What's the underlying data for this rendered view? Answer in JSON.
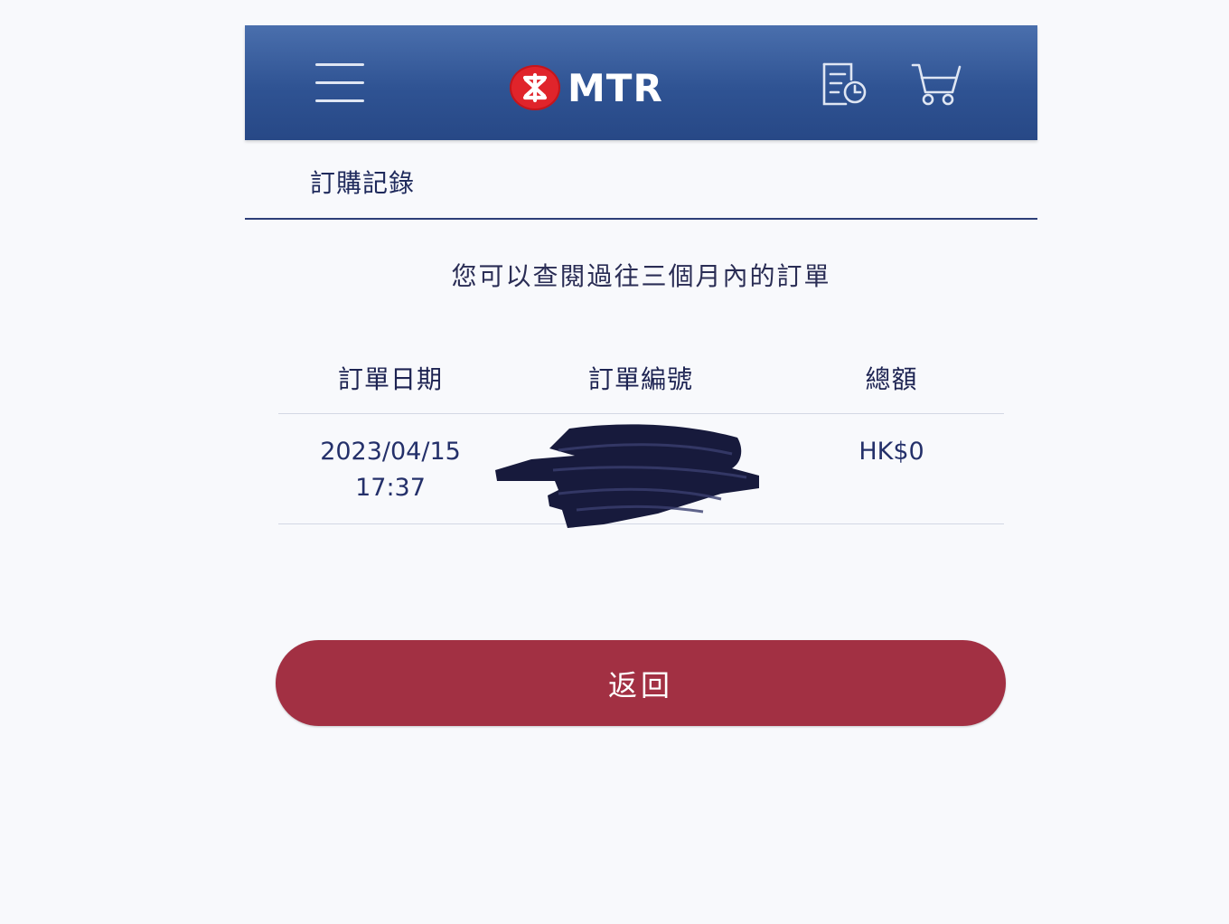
{
  "header": {
    "brand": "MTR",
    "menu_icon": "hamburger-menu-icon",
    "history_icon": "order-history-icon",
    "cart_icon": "shopping-cart-icon",
    "colors": {
      "bar": "#2f5393",
      "logo_red": "#e0242b"
    }
  },
  "page": {
    "title": "訂購記錄",
    "notice": "您可以查閱過往三個月內的訂單"
  },
  "orders": {
    "columns": [
      "訂單日期",
      "訂單編號",
      "總額"
    ],
    "rows": [
      {
        "date": "2023/04/15",
        "time": "17:37",
        "order_no_redacted": true,
        "total": "HK$0"
      }
    ]
  },
  "actions": {
    "back_label": "返回",
    "back_color": "#a23043"
  }
}
